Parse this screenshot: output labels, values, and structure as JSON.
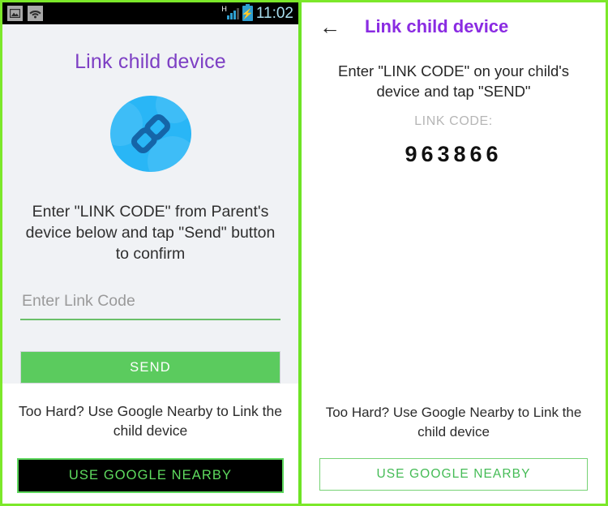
{
  "colors": {
    "frame_green": "#7ce82a",
    "divider_green": "#6ee325",
    "left_title_purple": "#7d3fc4",
    "right_title_purple": "#8a2be2",
    "send_green": "#5bcb5e",
    "underline_green": "#6abf69",
    "nearby_dark_bg": "#000000",
    "nearby_text_green": "#5fdc5f",
    "link_circle_blue": "#29b6f6",
    "status_time_blue": "#a9dff0",
    "left_panel_bg": "#f0f2f5"
  },
  "left_panel": {
    "statusbar": {
      "icons_left": [
        "image-icon",
        "wifi-icon"
      ],
      "network_type": "H",
      "icons_right": [
        "signal-icon",
        "battery-charging-icon"
      ],
      "time": "11:02"
    },
    "title": "Link child device",
    "hero_icon": "chain-link-icon",
    "instruction": "Enter \"LINK CODE\" from Parent's device below and tap \"Send\" button to confirm",
    "code_input": {
      "placeholder": "Enter Link Code",
      "value": ""
    },
    "send_label": "SEND",
    "hint": "Too Hard? Use Google Nearby to Link the child device",
    "nearby_label": "USE GOOGLE NEARBY"
  },
  "right_panel": {
    "back_icon": "back-arrow-icon",
    "title": "Link child device",
    "instruction": "Enter \"LINK CODE\" on your child's device and tap \"SEND\"",
    "link_code_label": "LINK CODE:",
    "link_code_value": "963866",
    "hint": "Too Hard? Use Google Nearby to Link the child device",
    "nearby_label": "USE GOOGLE NEARBY"
  }
}
